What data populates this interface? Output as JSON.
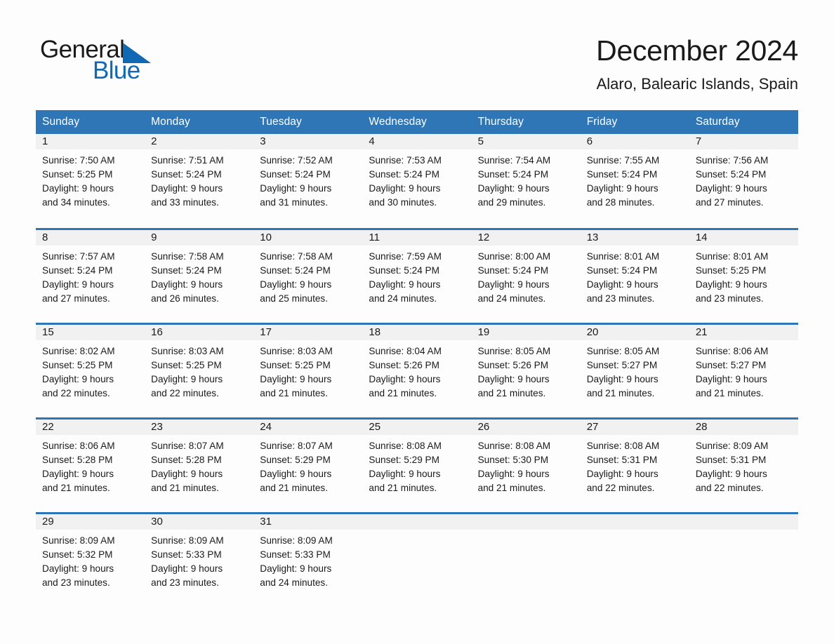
{
  "brand": {
    "name_part1": "General",
    "name_part2": "Blue",
    "triangle_color": "#1168b3",
    "text_color": "#1a1a1a"
  },
  "header": {
    "title": "December 2024",
    "subtitle": "Alaro, Balearic Islands, Spain"
  },
  "theme": {
    "header_bg": "#2f76b6",
    "header_text": "#ffffff",
    "daynum_bg": "#f1f1f1",
    "row_separator": "#2f76b6",
    "page_bg": "#fdfdfd"
  },
  "weekday_headers": [
    "Sunday",
    "Monday",
    "Tuesday",
    "Wednesday",
    "Thursday",
    "Friday",
    "Saturday"
  ],
  "labels": {
    "sunrise_prefix": "Sunrise:",
    "sunset_prefix": "Sunset:",
    "daylight_prefix": "Daylight:"
  },
  "weeks": [
    [
      {
        "day": "1",
        "sunrise": "Sunrise: 7:50 AM",
        "sunset": "Sunset: 5:25 PM",
        "daylight_line1": "Daylight: 9 hours",
        "daylight_line2": "and 34 minutes."
      },
      {
        "day": "2",
        "sunrise": "Sunrise: 7:51 AM",
        "sunset": "Sunset: 5:24 PM",
        "daylight_line1": "Daylight: 9 hours",
        "daylight_line2": "and 33 minutes."
      },
      {
        "day": "3",
        "sunrise": "Sunrise: 7:52 AM",
        "sunset": "Sunset: 5:24 PM",
        "daylight_line1": "Daylight: 9 hours",
        "daylight_line2": "and 31 minutes."
      },
      {
        "day": "4",
        "sunrise": "Sunrise: 7:53 AM",
        "sunset": "Sunset: 5:24 PM",
        "daylight_line1": "Daylight: 9 hours",
        "daylight_line2": "and 30 minutes."
      },
      {
        "day": "5",
        "sunrise": "Sunrise: 7:54 AM",
        "sunset": "Sunset: 5:24 PM",
        "daylight_line1": "Daylight: 9 hours",
        "daylight_line2": "and 29 minutes."
      },
      {
        "day": "6",
        "sunrise": "Sunrise: 7:55 AM",
        "sunset": "Sunset: 5:24 PM",
        "daylight_line1": "Daylight: 9 hours",
        "daylight_line2": "and 28 minutes."
      },
      {
        "day": "7",
        "sunrise": "Sunrise: 7:56 AM",
        "sunset": "Sunset: 5:24 PM",
        "daylight_line1": "Daylight: 9 hours",
        "daylight_line2": "and 27 minutes."
      }
    ],
    [
      {
        "day": "8",
        "sunrise": "Sunrise: 7:57 AM",
        "sunset": "Sunset: 5:24 PM",
        "daylight_line1": "Daylight: 9 hours",
        "daylight_line2": "and 27 minutes."
      },
      {
        "day": "9",
        "sunrise": "Sunrise: 7:58 AM",
        "sunset": "Sunset: 5:24 PM",
        "daylight_line1": "Daylight: 9 hours",
        "daylight_line2": "and 26 minutes."
      },
      {
        "day": "10",
        "sunrise": "Sunrise: 7:58 AM",
        "sunset": "Sunset: 5:24 PM",
        "daylight_line1": "Daylight: 9 hours",
        "daylight_line2": "and 25 minutes."
      },
      {
        "day": "11",
        "sunrise": "Sunrise: 7:59 AM",
        "sunset": "Sunset: 5:24 PM",
        "daylight_line1": "Daylight: 9 hours",
        "daylight_line2": "and 24 minutes."
      },
      {
        "day": "12",
        "sunrise": "Sunrise: 8:00 AM",
        "sunset": "Sunset: 5:24 PM",
        "daylight_line1": "Daylight: 9 hours",
        "daylight_line2": "and 24 minutes."
      },
      {
        "day": "13",
        "sunrise": "Sunrise: 8:01 AM",
        "sunset": "Sunset: 5:24 PM",
        "daylight_line1": "Daylight: 9 hours",
        "daylight_line2": "and 23 minutes."
      },
      {
        "day": "14",
        "sunrise": "Sunrise: 8:01 AM",
        "sunset": "Sunset: 5:25 PM",
        "daylight_line1": "Daylight: 9 hours",
        "daylight_line2": "and 23 minutes."
      }
    ],
    [
      {
        "day": "15",
        "sunrise": "Sunrise: 8:02 AM",
        "sunset": "Sunset: 5:25 PM",
        "daylight_line1": "Daylight: 9 hours",
        "daylight_line2": "and 22 minutes."
      },
      {
        "day": "16",
        "sunrise": "Sunrise: 8:03 AM",
        "sunset": "Sunset: 5:25 PM",
        "daylight_line1": "Daylight: 9 hours",
        "daylight_line2": "and 22 minutes."
      },
      {
        "day": "17",
        "sunrise": "Sunrise: 8:03 AM",
        "sunset": "Sunset: 5:25 PM",
        "daylight_line1": "Daylight: 9 hours",
        "daylight_line2": "and 21 minutes."
      },
      {
        "day": "18",
        "sunrise": "Sunrise: 8:04 AM",
        "sunset": "Sunset: 5:26 PM",
        "daylight_line1": "Daylight: 9 hours",
        "daylight_line2": "and 21 minutes."
      },
      {
        "day": "19",
        "sunrise": "Sunrise: 8:05 AM",
        "sunset": "Sunset: 5:26 PM",
        "daylight_line1": "Daylight: 9 hours",
        "daylight_line2": "and 21 minutes."
      },
      {
        "day": "20",
        "sunrise": "Sunrise: 8:05 AM",
        "sunset": "Sunset: 5:27 PM",
        "daylight_line1": "Daylight: 9 hours",
        "daylight_line2": "and 21 minutes."
      },
      {
        "day": "21",
        "sunrise": "Sunrise: 8:06 AM",
        "sunset": "Sunset: 5:27 PM",
        "daylight_line1": "Daylight: 9 hours",
        "daylight_line2": "and 21 minutes."
      }
    ],
    [
      {
        "day": "22",
        "sunrise": "Sunrise: 8:06 AM",
        "sunset": "Sunset: 5:28 PM",
        "daylight_line1": "Daylight: 9 hours",
        "daylight_line2": "and 21 minutes."
      },
      {
        "day": "23",
        "sunrise": "Sunrise: 8:07 AM",
        "sunset": "Sunset: 5:28 PM",
        "daylight_line1": "Daylight: 9 hours",
        "daylight_line2": "and 21 minutes."
      },
      {
        "day": "24",
        "sunrise": "Sunrise: 8:07 AM",
        "sunset": "Sunset: 5:29 PM",
        "daylight_line1": "Daylight: 9 hours",
        "daylight_line2": "and 21 minutes."
      },
      {
        "day": "25",
        "sunrise": "Sunrise: 8:08 AM",
        "sunset": "Sunset: 5:29 PM",
        "daylight_line1": "Daylight: 9 hours",
        "daylight_line2": "and 21 minutes."
      },
      {
        "day": "26",
        "sunrise": "Sunrise: 8:08 AM",
        "sunset": "Sunset: 5:30 PM",
        "daylight_line1": "Daylight: 9 hours",
        "daylight_line2": "and 21 minutes."
      },
      {
        "day": "27",
        "sunrise": "Sunrise: 8:08 AM",
        "sunset": "Sunset: 5:31 PM",
        "daylight_line1": "Daylight: 9 hours",
        "daylight_line2": "and 22 minutes."
      },
      {
        "day": "28",
        "sunrise": "Sunrise: 8:09 AM",
        "sunset": "Sunset: 5:31 PM",
        "daylight_line1": "Daylight: 9 hours",
        "daylight_line2": "and 22 minutes."
      }
    ],
    [
      {
        "day": "29",
        "sunrise": "Sunrise: 8:09 AM",
        "sunset": "Sunset: 5:32 PM",
        "daylight_line1": "Daylight: 9 hours",
        "daylight_line2": "and 23 minutes."
      },
      {
        "day": "30",
        "sunrise": "Sunrise: 8:09 AM",
        "sunset": "Sunset: 5:33 PM",
        "daylight_line1": "Daylight: 9 hours",
        "daylight_line2": "and 23 minutes."
      },
      {
        "day": "31",
        "sunrise": "Sunrise: 8:09 AM",
        "sunset": "Sunset: 5:33 PM",
        "daylight_line1": "Daylight: 9 hours",
        "daylight_line2": "and 24 minutes."
      },
      {
        "day": "",
        "sunrise": "",
        "sunset": "",
        "daylight_line1": "",
        "daylight_line2": ""
      },
      {
        "day": "",
        "sunrise": "",
        "sunset": "",
        "daylight_line1": "",
        "daylight_line2": ""
      },
      {
        "day": "",
        "sunrise": "",
        "sunset": "",
        "daylight_line1": "",
        "daylight_line2": ""
      },
      {
        "day": "",
        "sunrise": "",
        "sunset": "",
        "daylight_line1": "",
        "daylight_line2": ""
      }
    ]
  ]
}
